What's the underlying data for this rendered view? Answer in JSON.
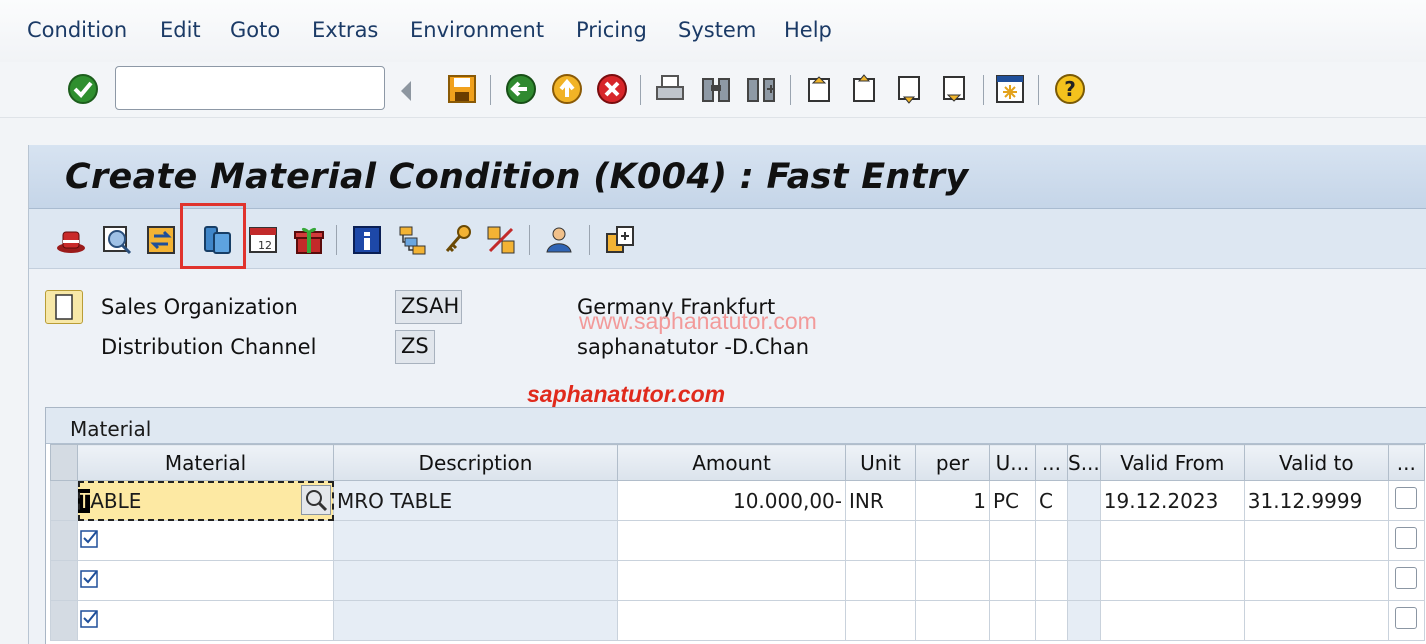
{
  "menu": {
    "items": [
      "Condition",
      "Edit",
      "Goto",
      "Extras",
      "Environment",
      "Pricing",
      "System",
      "Help"
    ]
  },
  "system_toolbar": {
    "command_field_value": "",
    "icons": [
      "enter-icon",
      "history-arrow-icon",
      "save-icon",
      "back-icon",
      "exit-icon",
      "cancel-icon",
      "print-icon",
      "find-icon",
      "find-next-icon",
      "first-page-icon",
      "previous-page-icon",
      "next-page-icon",
      "last-page-icon",
      "create-session-icon",
      "help-icon"
    ]
  },
  "screen": {
    "title": "Create Material Condition (K004) : Fast Entry"
  },
  "app_toolbar": {
    "icons": [
      "condition-info-icon",
      "display-scales-icon",
      "change-condition-icon",
      "copy-records-icon",
      "validity-periods-icon",
      "additional-data-icon",
      "details-info-icon",
      "key-combination-icon",
      "variable-key-icon",
      "compare-icon",
      "customer-icon",
      "other-condition-type-icon"
    ],
    "highlighted_icon": "copy-records-icon"
  },
  "header": {
    "sales_org_label": "Sales Organization",
    "sales_org_value": "ZSAH",
    "sales_org_text": "Germany Frankfurt",
    "dist_channel_label": "Distribution Channel",
    "dist_channel_value": "ZS",
    "dist_channel_text": "saphanatutor -D.Chan",
    "watermark": "www.saphanatutor.com",
    "brand": "saphanatutor.com"
  },
  "table": {
    "title": "Material",
    "columns": [
      "Material",
      "Description",
      "Amount",
      "Unit",
      "per",
      "U...",
      "...",
      "S...",
      "Valid From",
      "Valid to",
      "..."
    ],
    "rows": [
      {
        "material": "TABLE",
        "description": "MRO TABLE",
        "amount": "10.000,00-",
        "unit": "INR",
        "per": "1",
        "uom": "PC",
        "calc": "C",
        "scale": "",
        "valid_from": "19.12.2023",
        "valid_to": "31.12.9999"
      },
      {
        "material": "",
        "description": "",
        "amount": "",
        "unit": "",
        "per": "",
        "uom": "",
        "calc": "",
        "scale": "",
        "valid_from": "",
        "valid_to": ""
      },
      {
        "material": "",
        "description": "",
        "amount": "",
        "unit": "",
        "per": "",
        "uom": "",
        "calc": "",
        "scale": "",
        "valid_from": "",
        "valid_to": ""
      },
      {
        "material": "",
        "description": "",
        "amount": "",
        "unit": "",
        "per": "",
        "uom": "",
        "calc": "",
        "scale": "",
        "valid_from": "",
        "valid_to": ""
      }
    ]
  },
  "colors": {
    "title_bar": "#c9d8ea",
    "menu_text": "#1b3a66",
    "highlight_box": "#e0332d",
    "input_focus": "#fde9a3",
    "brand_red": "#e02a1c"
  }
}
